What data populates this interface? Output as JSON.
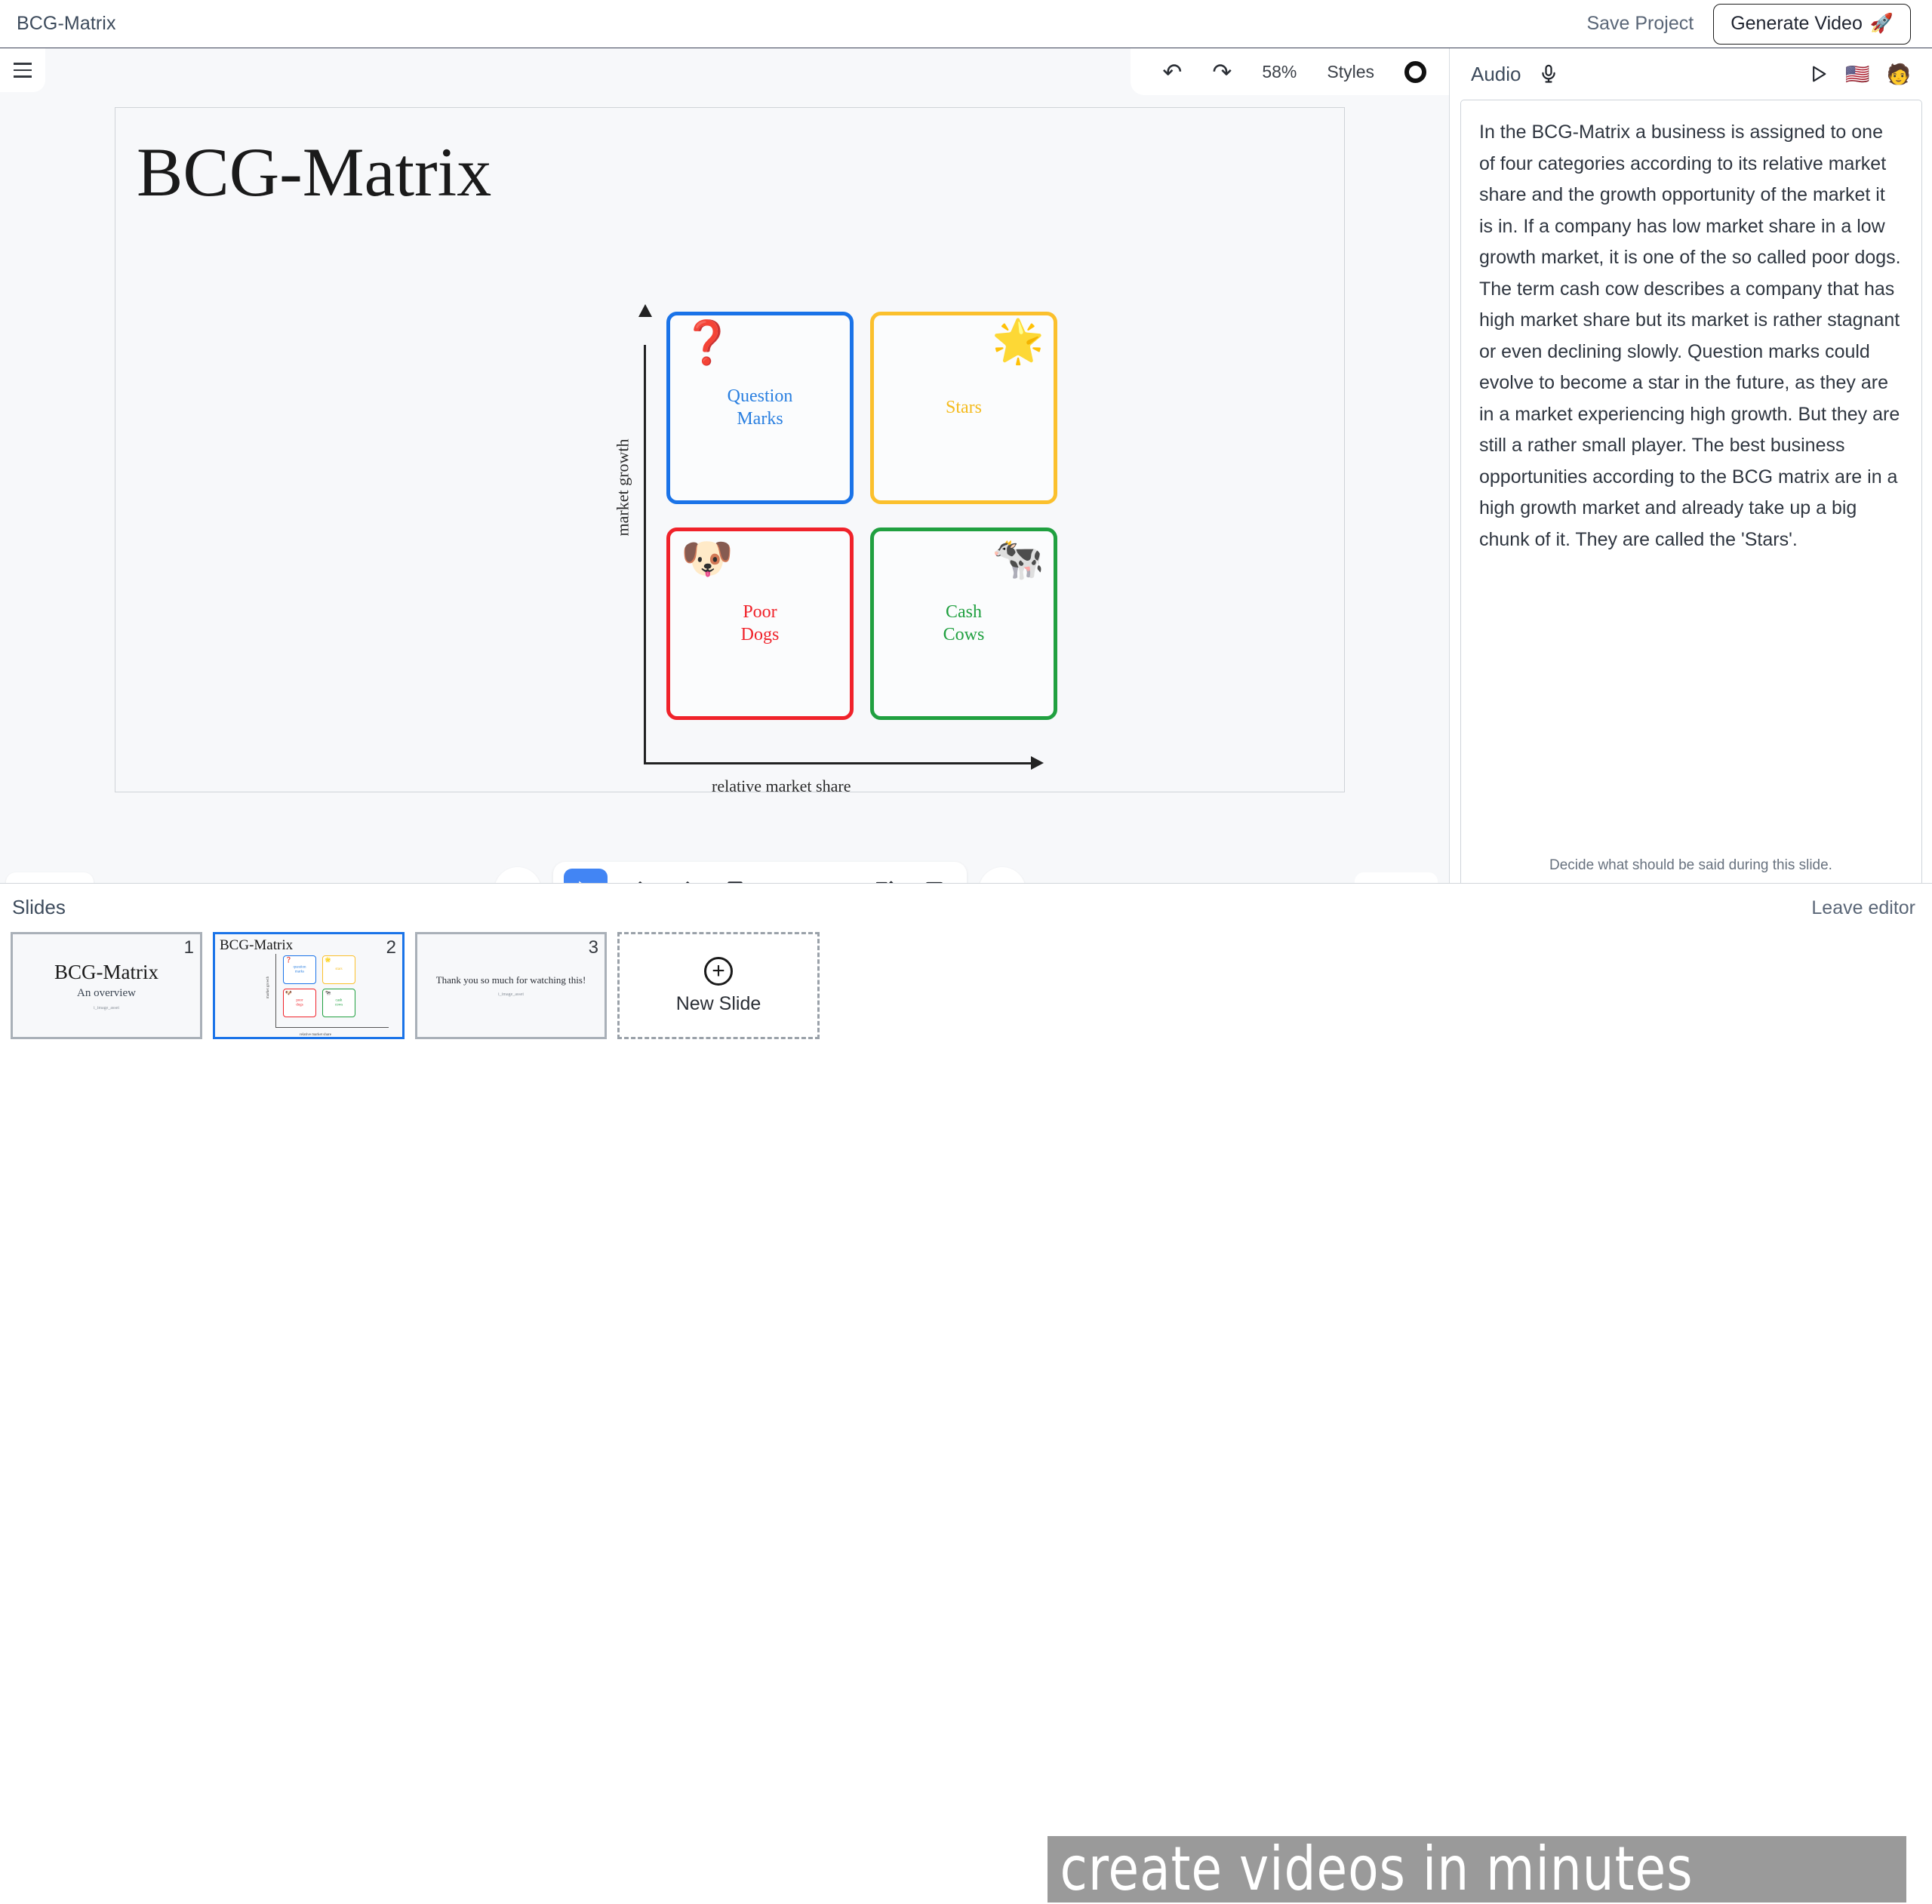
{
  "topbar": {
    "project_title": "BCG-Matrix",
    "save_label": "Save Project",
    "generate_label": "Generate Video",
    "rocket_icon": "🚀"
  },
  "canvas_toolbar": {
    "undo_icon": "↶",
    "redo_icon": "↷",
    "zoom_level": "58%",
    "styles_label": "Styles"
  },
  "slide": {
    "heading": "BCG-Matrix",
    "axis_y_label": "market growth",
    "axis_x_label": "relative market share",
    "quadrants": [
      {
        "id": "question-marks",
        "label": "Question\nMarks",
        "color": "#2a7fe0",
        "border": "#1a73e8",
        "emoji": "❓"
      },
      {
        "id": "stars",
        "label": "Stars",
        "color": "#f5bb1d",
        "border": "#fbc02d",
        "emoji": "🌟"
      },
      {
        "id": "poor-dogs",
        "label": "Poor\nDogs",
        "color": "#f0222a",
        "border": "#f0222a",
        "emoji": "🐶"
      },
      {
        "id": "cash-cows",
        "label": "Cash\nCows",
        "color": "#20a040",
        "border": "#20a040",
        "emoji": "🐄"
      }
    ]
  },
  "draw_toolbar": {
    "more_icon": "⋯",
    "tools": [
      {
        "name": "select-tool",
        "active": true
      },
      {
        "name": "pencil-tool",
        "active": false
      },
      {
        "name": "eraser-tool",
        "active": false
      },
      {
        "name": "rectangle-tool",
        "active": false
      },
      {
        "name": "arrow-tool",
        "active": false
      },
      {
        "name": "text-tool",
        "active": false
      },
      {
        "name": "note-tool",
        "active": false
      },
      {
        "name": "image-tool",
        "active": false
      }
    ]
  },
  "nav": {
    "prev_icon": "←",
    "next_icon": "→"
  },
  "audio": {
    "title": "Audio",
    "flag_emoji": "🇺🇸",
    "person_emoji": "🧑",
    "script": "In the BCG-Matrix a business is assigned to one of four categories according to its relative market share and the growth opportunity of the market it is in. If a company has low market share in a low growth market, it is one of the so called poor dogs. The term cash cow describes a company that has high market share but its market is rather stagnant or even declining slowly. Question marks could evolve to become a star in the future, as they are in a market experiencing high growth. But they are still a rather small player. The best business opportunities according to the BCG matrix are in a high growth market and already take up a big chunk of it. They are called the 'Stars'.",
    "hint": "Decide what should be said during this slide."
  },
  "slides_panel": {
    "title": "Slides",
    "leave_editor": "Leave editor",
    "new_slide_label": "New Slide",
    "thumbs": [
      {
        "number": "1",
        "selected": false,
        "center_title": "BCG-Matrix",
        "center_sub": "An overview",
        "tiny": "i_image_asset"
      },
      {
        "number": "2",
        "selected": true,
        "top_left_title": "BCG-Matrix",
        "mini": {
          "q1": "question\nmarks",
          "q2": "stars",
          "q3": "poor\ndogs",
          "q4": "cash\ncows",
          "xlabel": "relative market share",
          "ylabel": "market growth"
        }
      },
      {
        "number": "3",
        "selected": false,
        "thanks": "Thank you so much for watching this!",
        "tiny": "i_image_asset"
      }
    ]
  },
  "promo": {
    "text": "create videos in minutes"
  }
}
